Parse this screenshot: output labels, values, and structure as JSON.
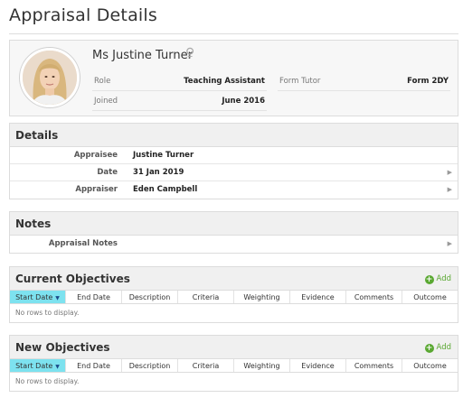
{
  "page": {
    "title": "Appraisal Details"
  },
  "profile": {
    "name": "Ms Justine Turner",
    "gender_icon": "female-symbol-icon",
    "gender_glyph": "♀",
    "role_label": "Role",
    "role_value": "Teaching Assistant",
    "joined_label": "Joined",
    "joined_value": "June 2016",
    "tutor_label": "Form Tutor",
    "tutor_value": "Form 2DY"
  },
  "details": {
    "heading": "Details",
    "rows": [
      {
        "label": "Appraisee",
        "value": "Justine Turner"
      },
      {
        "label": "Date",
        "value": "31 Jan 2019"
      },
      {
        "label": "Appraiser",
        "value": "Eden Campbell"
      }
    ]
  },
  "notes": {
    "heading": "Notes",
    "rows": [
      {
        "label": "Appraisal Notes",
        "value": ""
      }
    ]
  },
  "grid_columns": [
    "Start Date",
    "End Date",
    "Description",
    "Criteria",
    "Weighting",
    "Evidence",
    "Comments",
    "Outcome"
  ],
  "current_objectives": {
    "heading": "Current Objectives",
    "add_label": "Add",
    "empty_text": "No rows to display."
  },
  "new_objectives": {
    "heading": "New Objectives",
    "add_label": "Add",
    "empty_text": "No rows to display."
  },
  "colors": {
    "accent_sort": "#7de2ef",
    "add_green": "#5aa832"
  },
  "icons": {
    "arrow": "chevron-right-icon",
    "add": "plus-circle-icon",
    "sort": "sort-down-icon"
  }
}
